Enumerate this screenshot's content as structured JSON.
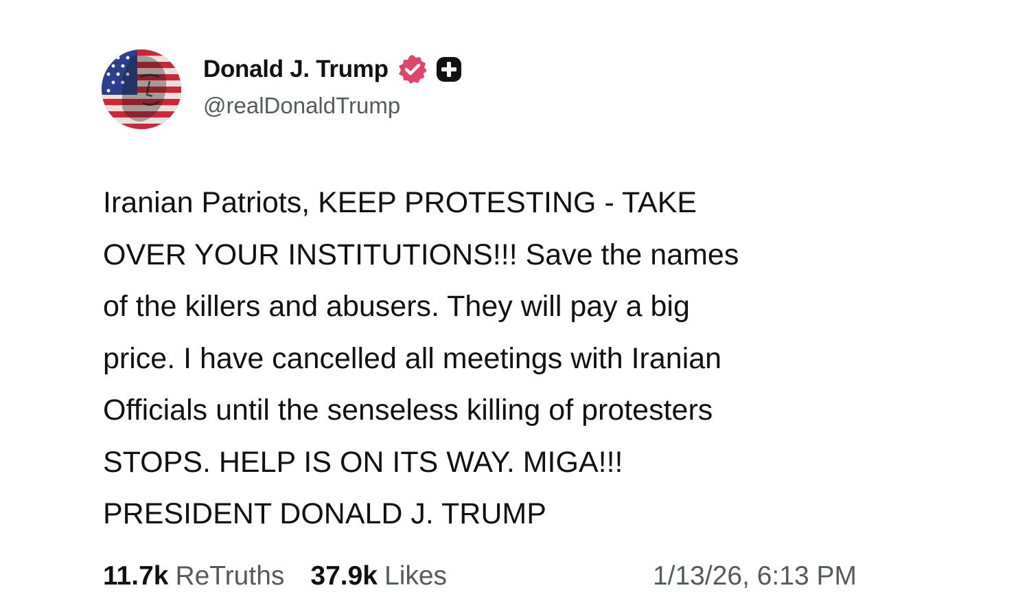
{
  "author": {
    "display_name": "Donald J. Trump",
    "handle": "@realDonaldTrump",
    "avatar_icon": "flag-portrait-avatar",
    "verified_icon": "verified-badge-icon",
    "plus_icon": "plus-badge-icon"
  },
  "post": {
    "text": "Iranian Patriots, KEEP PROTESTING - TAKE\nOVER YOUR INSTITUTIONS!!! Save the names\nof the killers and abusers. They will pay a big\nprice. I have cancelled all meetings with Iranian\nOfficials until the senseless killing of protesters\nSTOPS. HELP IS ON ITS WAY. MIGA!!!\nPRESIDENT DONALD J. TRUMP"
  },
  "stats": {
    "retruths_count": "11.7k",
    "retruths_label": "ReTruths",
    "likes_count": "37.9k",
    "likes_label": "Likes",
    "timestamp": "1/13/26, 6:13 PM"
  },
  "colors": {
    "verified_badge": "#e0456a",
    "text_primary": "#111111",
    "text_secondary": "#555a5f"
  }
}
